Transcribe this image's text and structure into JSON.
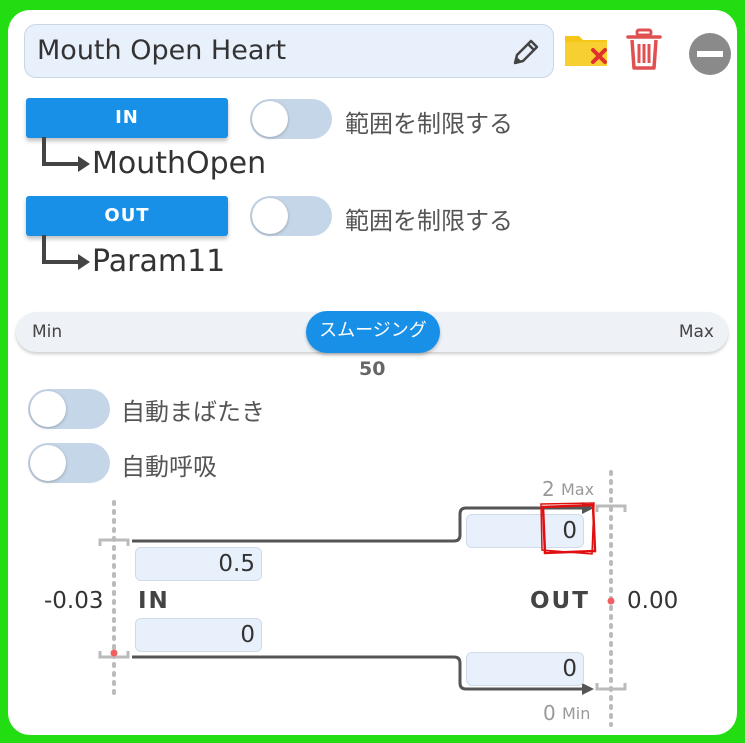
{
  "name_field": {
    "value": "Mouth Open Heart"
  },
  "input": {
    "button_label": "IN",
    "range_toggle_label": "範囲を制限する",
    "param": "MouthOpen"
  },
  "output": {
    "button_label": "OUT",
    "range_toggle_label": "範囲を制限する",
    "param": "Param11"
  },
  "smoothing": {
    "min_label": "Min",
    "max_label": "Max",
    "thumb_label": "スムージング",
    "value": "50"
  },
  "toggles": {
    "auto_blink": "自動まばたき",
    "auto_breath": "自動呼吸"
  },
  "graph": {
    "in_label": "IN",
    "out_label": "OUT",
    "in_current": "-0.03",
    "out_current": "0.00",
    "in_max_value": "0.5",
    "in_min_value": "0",
    "out_max_value": "0",
    "out_min_value": "0",
    "out_max_number": "2",
    "out_max_tag": "Max",
    "out_min_number": "0",
    "out_min_tag": "Min"
  },
  "colors": {
    "accent": "#1890e8",
    "border_green": "#22dd11",
    "toggle_off": "#c5d6e8",
    "folder": "#f5c518",
    "delete_red": "#e05050",
    "highlight_red": "#e01010"
  },
  "icons": [
    "pencil-icon",
    "folder-remove-icon",
    "trash-icon",
    "minus-circle-icon",
    "arrow-right-icon"
  ]
}
